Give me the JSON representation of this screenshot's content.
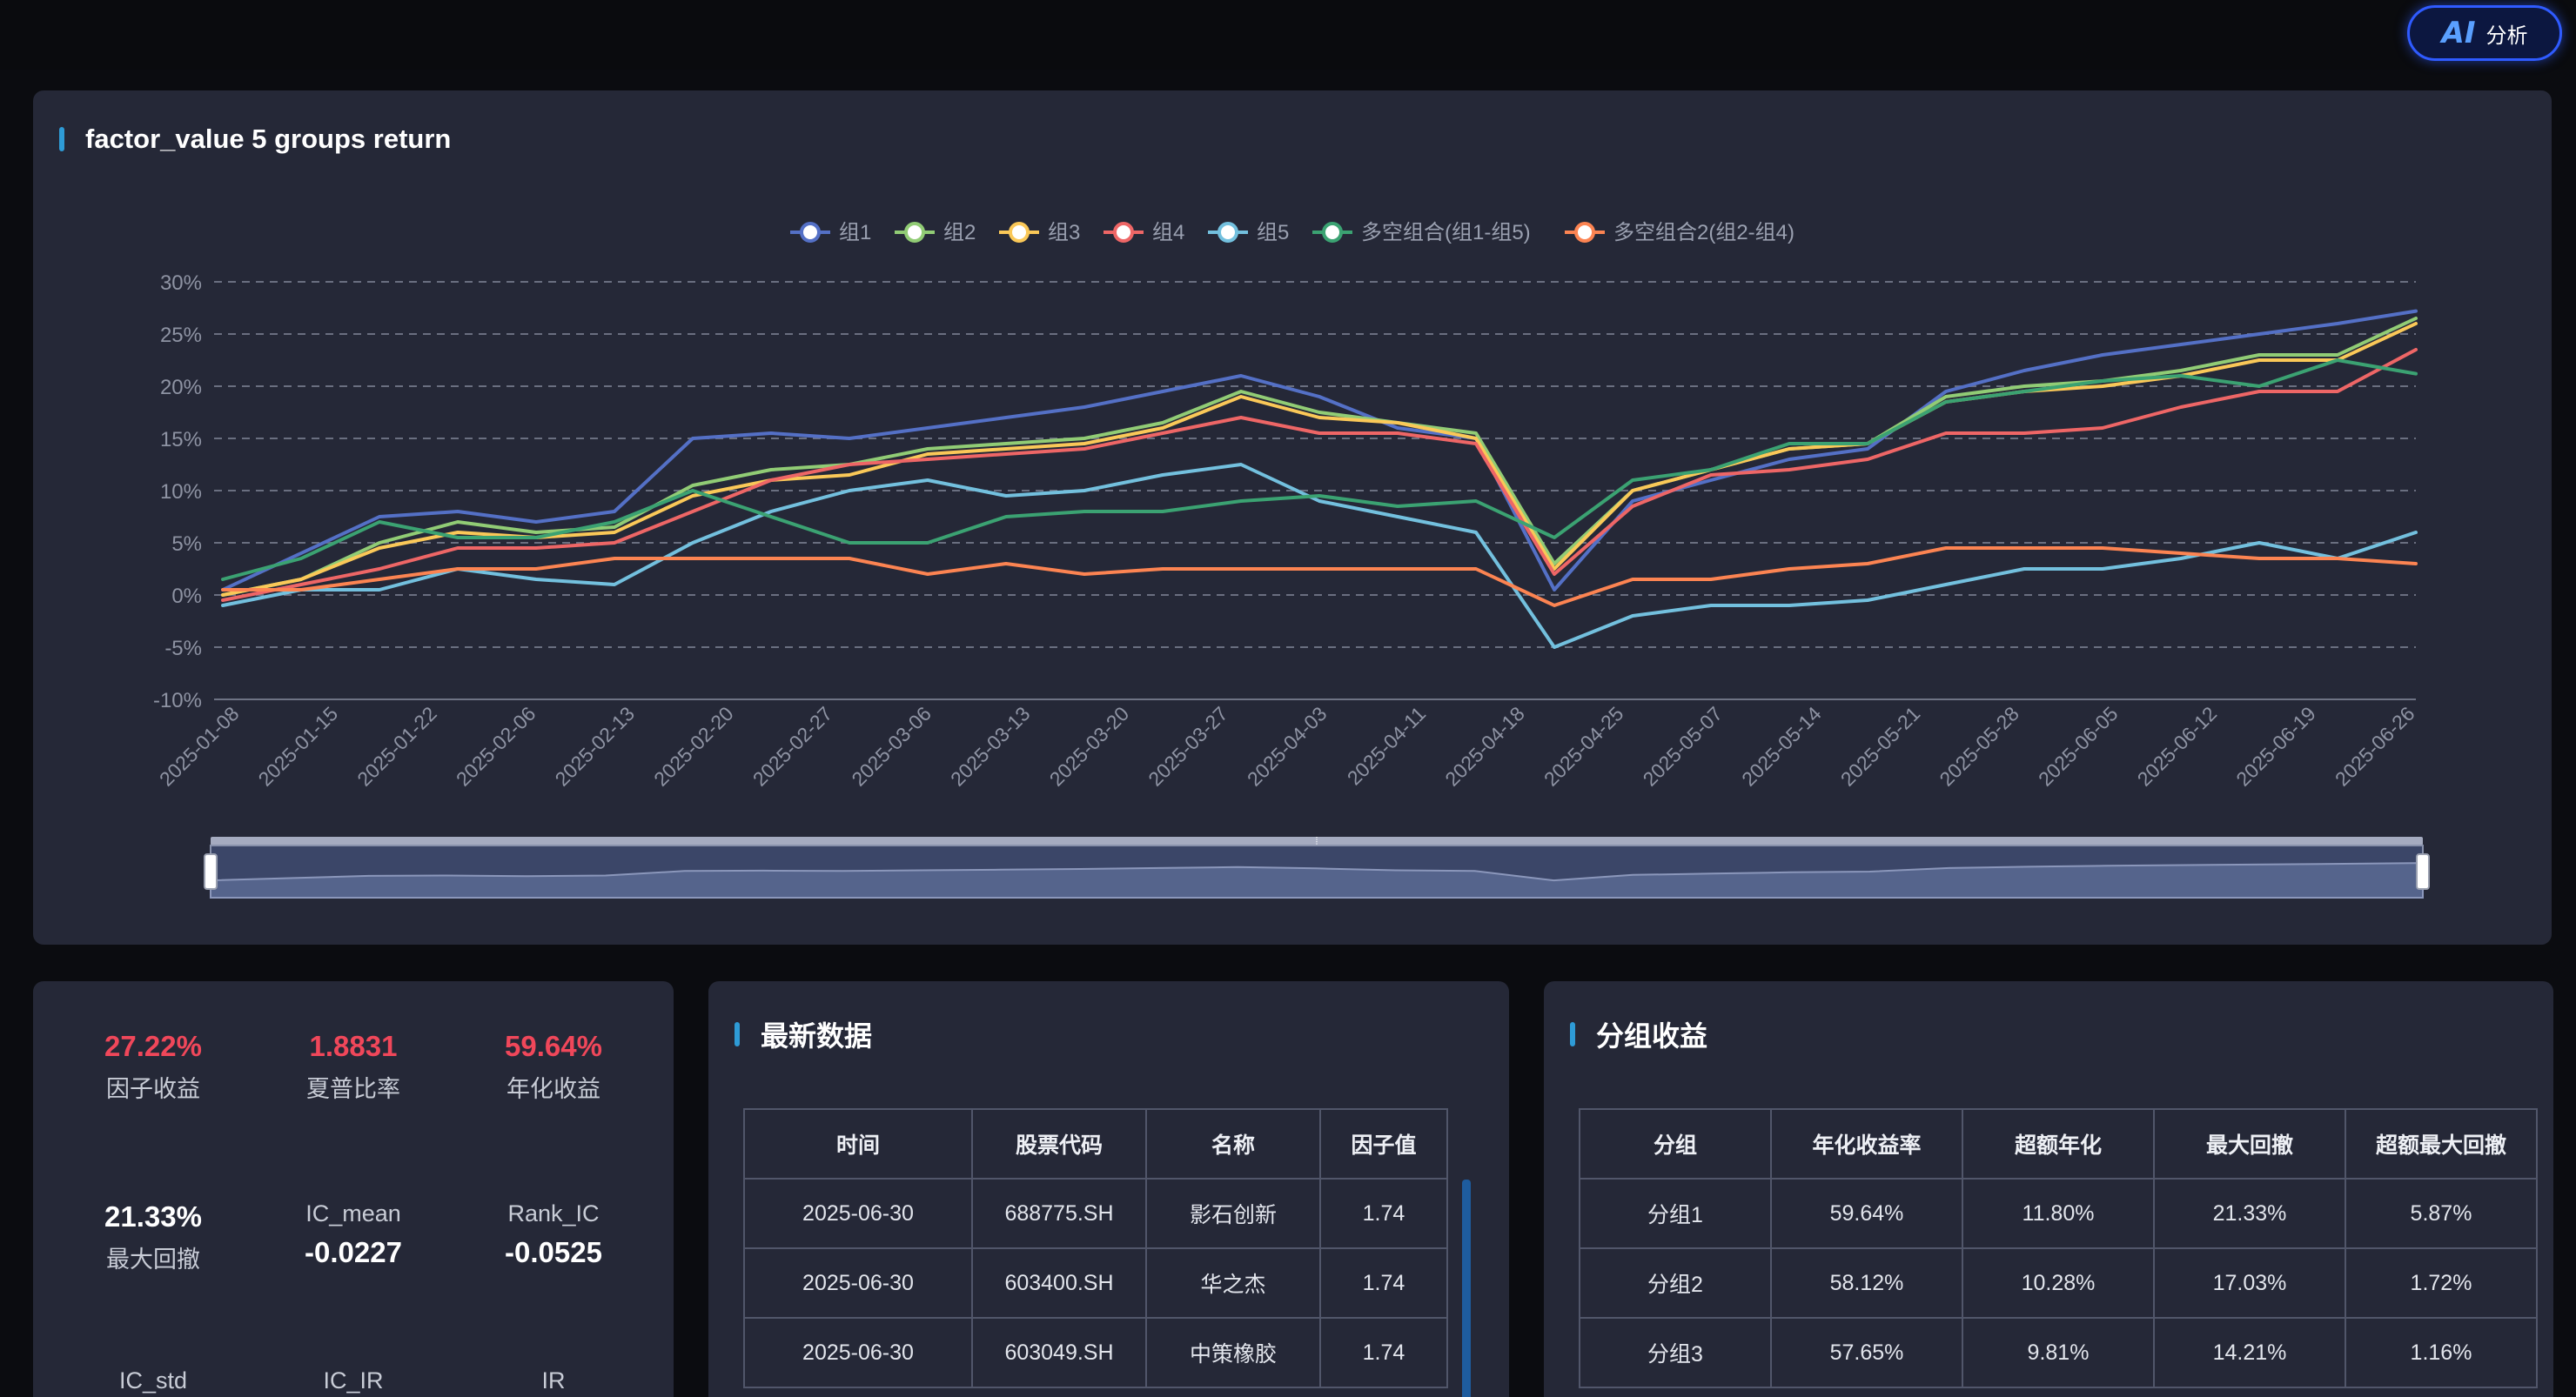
{
  "ai_button": {
    "logo": "AI",
    "label": "分析"
  },
  "chart_panel": {
    "title": "factor_value 5 groups return"
  },
  "colors": {
    "组1": "#5470c6",
    "组2": "#91cc75",
    "组3": "#fac858",
    "组4": "#ee6666",
    "组5": "#73c0de",
    "多空组合(组1-组5)": "#3ba272",
    "多空组合2(组2-组4)": "#fc8452"
  },
  "chart_data": {
    "type": "line",
    "title": "factor_value 5 groups return",
    "x_ticks": [
      "2025-01-08",
      "2025-01-15",
      "2025-01-22",
      "2025-02-06",
      "2025-02-13",
      "2025-02-20",
      "2025-02-27",
      "2025-03-06",
      "2025-03-13",
      "2025-03-20",
      "2025-03-27",
      "2025-04-03",
      "2025-04-11",
      "2025-04-18",
      "2025-04-25",
      "2025-05-07",
      "2025-05-14",
      "2025-05-21",
      "2025-05-28",
      "2025-06-05",
      "2025-06-12",
      "2025-06-19",
      "2025-06-26"
    ],
    "y_ticks": [
      "30%",
      "25%",
      "20%",
      "15%",
      "10%",
      "5%",
      "0%",
      "-5%",
      "-10%"
    ],
    "ylim": [
      -10,
      30
    ],
    "grid": true,
    "legend_position": "top-center",
    "series": [
      {
        "name": "组1",
        "values": [
          0.5,
          4.0,
          7.5,
          8.0,
          7.0,
          8.0,
          15.0,
          15.5,
          15.0,
          16.0,
          17.0,
          18.0,
          19.5,
          21.0,
          19.0,
          16.0,
          15.0,
          0.5,
          9.0,
          11.0,
          13.0,
          14.0,
          19.5,
          21.5,
          23.0,
          24.0,
          25.0,
          26.0,
          27.2
        ]
      },
      {
        "name": "组2",
        "values": [
          0.0,
          1.5,
          5.0,
          7.0,
          6.0,
          6.5,
          10.5,
          12.0,
          12.5,
          14.0,
          14.5,
          15.0,
          16.5,
          19.5,
          17.5,
          16.5,
          15.5,
          3.0,
          10.0,
          12.0,
          14.0,
          14.5,
          19.0,
          20.0,
          20.5,
          21.5,
          23.0,
          23.0,
          26.5
        ]
      },
      {
        "name": "组3",
        "values": [
          0.0,
          1.5,
          4.5,
          6.0,
          5.5,
          6.0,
          9.5,
          11.0,
          11.5,
          13.5,
          14.0,
          14.5,
          16.0,
          19.0,
          17.0,
          16.5,
          15.0,
          2.5,
          10.0,
          12.0,
          14.0,
          14.5,
          18.5,
          19.5,
          20.0,
          21.0,
          22.5,
          22.5,
          26.0
        ]
      },
      {
        "name": "组4",
        "values": [
          -0.5,
          1.0,
          2.5,
          4.5,
          4.5,
          5.0,
          8.0,
          11.0,
          12.5,
          13.0,
          13.5,
          14.0,
          15.5,
          17.0,
          15.5,
          15.5,
          14.5,
          2.0,
          8.5,
          11.5,
          12.0,
          13.0,
          15.5,
          15.5,
          16.0,
          18.0,
          19.5,
          19.5,
          23.5
        ]
      },
      {
        "name": "组5",
        "values": [
          -1.0,
          0.5,
          0.5,
          2.5,
          1.5,
          1.0,
          5.0,
          8.0,
          10.0,
          11.0,
          9.5,
          10.0,
          11.5,
          12.5,
          9.0,
          7.5,
          6.0,
          -5.0,
          -2.0,
          -1.0,
          -1.0,
          -0.5,
          1.0,
          2.5,
          2.5,
          3.5,
          5.0,
          3.5,
          6.0
        ]
      },
      {
        "name": "多空组合(组1-组5)",
        "values": [
          1.5,
          3.5,
          7.0,
          5.5,
          5.5,
          7.0,
          10.0,
          7.5,
          5.0,
          5.0,
          7.5,
          8.0,
          8.0,
          9.0,
          9.5,
          8.5,
          9.0,
          5.5,
          11.0,
          12.0,
          14.5,
          14.5,
          18.5,
          19.5,
          20.5,
          21.0,
          20.0,
          22.5,
          21.2
        ]
      },
      {
        "name": "多空组合2(组2-组4)",
        "values": [
          0.5,
          0.5,
          1.5,
          2.5,
          2.5,
          3.5,
          3.5,
          3.5,
          3.5,
          2.0,
          3.0,
          2.0,
          2.5,
          2.5,
          2.5,
          2.5,
          2.5,
          -1.0,
          1.5,
          1.5,
          2.5,
          3.0,
          4.5,
          4.5,
          4.5,
          4.0,
          3.5,
          3.5,
          3.0
        ]
      }
    ]
  },
  "stats": {
    "factor_return": {
      "value": "27.22%",
      "label": "因子收益"
    },
    "sharpe": {
      "value": "1.8831",
      "label": "夏普比率"
    },
    "annual_return": {
      "value": "59.64%",
      "label": "年化收益"
    },
    "max_drawdown": {
      "value": "21.33%",
      "label": "最大回撤"
    },
    "ic_mean": {
      "value": "-0.0227",
      "label": "IC_mean"
    },
    "rank_ic": {
      "value": "-0.0525",
      "label": "Rank_IC"
    },
    "ic_std": {
      "label": "IC_std"
    },
    "ic_ir": {
      "label": "IC_IR"
    },
    "ir": {
      "label": "IR"
    }
  },
  "latest": {
    "title": "最新数据",
    "headers": [
      "时间",
      "股票代码",
      "名称",
      "因子值"
    ],
    "rows": [
      [
        "2025-06-30",
        "688775.SH",
        "影石创新",
        "1.74"
      ],
      [
        "2025-06-30",
        "603400.SH",
        "华之杰",
        "1.74"
      ],
      [
        "2025-06-30",
        "603049.SH",
        "中策橡胶",
        "1.74"
      ]
    ]
  },
  "groups": {
    "title": "分组收益",
    "headers": [
      "分组",
      "年化收益率",
      "超额年化",
      "最大回撤",
      "超额最大回撤"
    ],
    "rows": [
      [
        "分组1",
        "59.64%",
        "11.80%",
        "21.33%",
        "5.87%"
      ],
      [
        "分组2",
        "58.12%",
        "10.28%",
        "17.03%",
        "1.72%"
      ],
      [
        "分组3",
        "57.65%",
        "9.81%",
        "14.21%",
        "1.16%"
      ]
    ]
  }
}
